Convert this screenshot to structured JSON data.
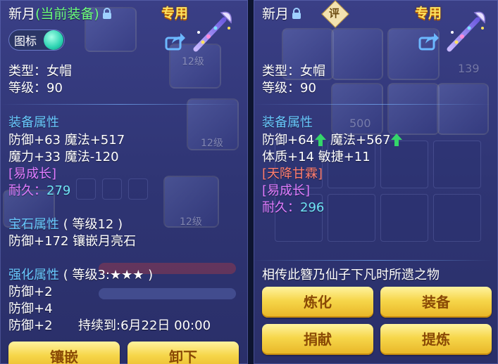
{
  "left": {
    "title_name": "新月",
    "title_status": "(当前装备)",
    "badge": "专用",
    "toggle_label": "图标",
    "type_line": "类型：女帽",
    "level_line": "等级：90",
    "attr_header": "装备属性",
    "attr_line1": "防御+63 魔法+517",
    "attr_line2": "魔力+33 魔法-120",
    "special_tag": "[易成长]",
    "durability_label": "耐久：",
    "durability_value": "279",
    "gem_header": "宝石属性",
    "gem_level": "( 等级12 )",
    "gem_line": "防御+172 镶嵌月亮石",
    "enh_header": "强化属性",
    "enh_level": "( 等级3:★★★ )",
    "enh_line1": "防御+2",
    "enh_line2": "防御+4",
    "enh_line3": "防御+2",
    "enh_duration": "持续到:6月22日 00:00",
    "btn_inlay": "镶嵌",
    "btn_unequip": "卸下"
  },
  "right": {
    "title_name": "新月",
    "eval_badge": "评",
    "badge": "专用",
    "type_line": "类型：女帽",
    "level_line": "等级：90",
    "attr_header": "装备属性",
    "attr_def": "防御+64",
    "attr_magic": "魔法+567",
    "attr_line2": "体质+14 敏捷+11",
    "special_tag1": "[天降甘霖]",
    "special_tag2": "[易成长]",
    "durability_label": "耐久：",
    "durability_value": "296",
    "description": "相传此簪乃仙子下凡时所遗之物",
    "btn_refine": "炼化",
    "btn_equip": "装备",
    "btn_donate": "捐献",
    "btn_extract": "提炼"
  },
  "colors": {
    "panel_bg": "#3a3f86",
    "header_blue": "#69c9ff",
    "cyan_value": "#6fe3f5",
    "magenta_tag": "#e07cff",
    "red_tag": "#ff7e70",
    "badge_gold": "#ffe25c",
    "button_gold": "#f6d64a",
    "arrow_green": "#34d66a"
  },
  "bg_numbers": {
    "level_12a": "12级",
    "level_12b": "12级",
    "level_12c": "12级",
    "count_139": "139",
    "count_500": "500"
  }
}
